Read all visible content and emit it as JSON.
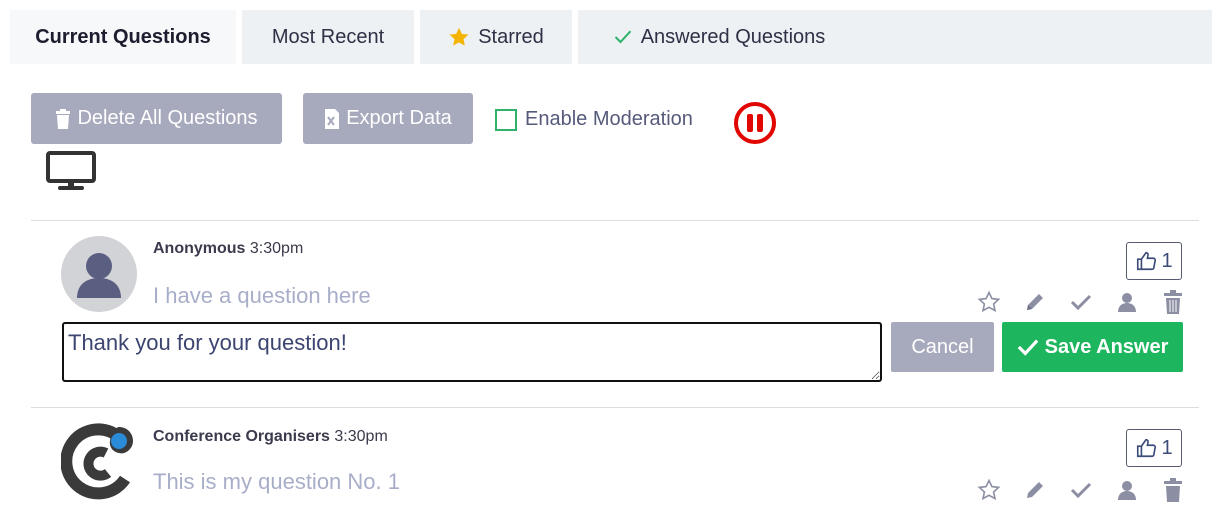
{
  "tabs": [
    {
      "label": "Current Questions",
      "icon": "none",
      "active": true
    },
    {
      "label": "Most Recent",
      "icon": "none",
      "active": false
    },
    {
      "label": "Starred",
      "icon": "star-icon",
      "active": false
    },
    {
      "label": "Answered Questions",
      "icon": "check-icon",
      "active": false
    }
  ],
  "toolbar": {
    "delete_all_label": "Delete All Questions",
    "export_label": "Export Data",
    "moderation_label": "Enable Moderation",
    "moderation_checked": false
  },
  "colors": {
    "accent_green": "#1db65f",
    "muted_button": "#a7a9bd",
    "pause_red": "#e10600",
    "question_text": "#a8aec9"
  },
  "questions": [
    {
      "author": "Anonymous",
      "time": "3:30pm",
      "text": "I have a question here",
      "likes": "1",
      "avatar": "default-user-avatar",
      "answer_value": "Thank you for your question!",
      "cancel_label": "Cancel",
      "save_label": "Save Answer"
    },
    {
      "author": "Conference Organisers",
      "time": "3:30pm",
      "text": "This is my question No. 1",
      "likes": "1",
      "avatar": "organiser-logo"
    }
  ]
}
